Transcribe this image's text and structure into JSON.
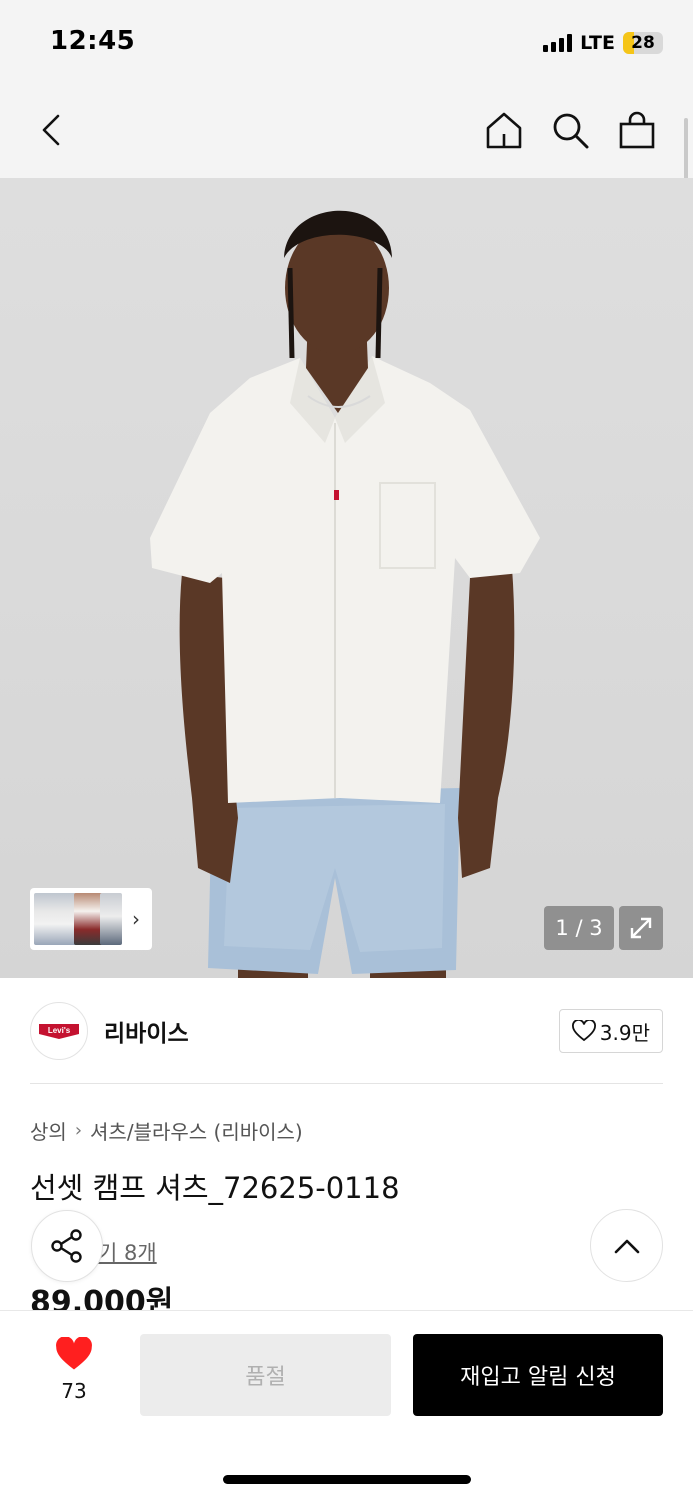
{
  "status_bar": {
    "time": "12:45",
    "network": "LTE",
    "battery_level": "28",
    "battery_fraction": 0.28,
    "battery_color": "#f5c518"
  },
  "nav": {
    "icons": [
      "chevron-left-icon",
      "home-icon",
      "search-icon",
      "shopping-bag-icon"
    ]
  },
  "gallery": {
    "image": "model-white-camp-shirt-denim-shorts",
    "counter": "1 / 3",
    "current": 1,
    "total": 3,
    "thumbnail_chevron": "›"
  },
  "brand": {
    "logo_text": "Levi's",
    "logo_color": "#c41230",
    "name": "리바이스",
    "likes": "3.9만"
  },
  "product": {
    "breadcrumb": [
      "상의",
      "셔츠/블라우스 (리바이스)"
    ],
    "title": "선셋 캠프 셔츠_72625-0118",
    "reviews": "후기 8개",
    "reviews_visible": "기 8개",
    "price": "89,000원"
  },
  "bottom_bar": {
    "wish_count": "73",
    "wish_color": "#ff1f1f",
    "soldout_label": "품절",
    "restock_label": "재입고 알림 신청"
  }
}
